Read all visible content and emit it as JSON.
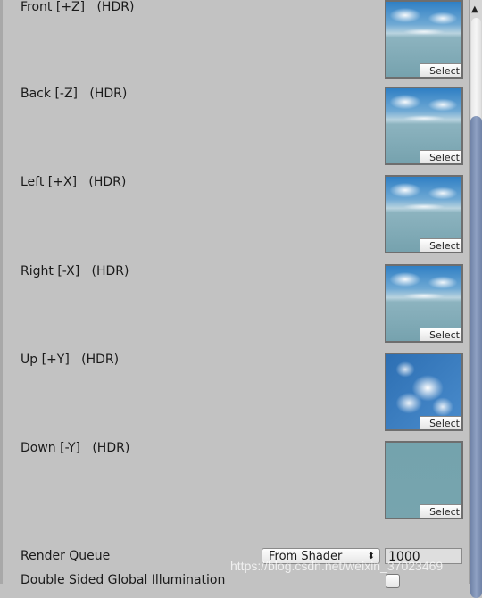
{
  "faces": [
    {
      "label": "Front [+Z]   (HDR)",
      "kind": "horizon"
    },
    {
      "label": "Back [-Z]   (HDR)",
      "kind": "horizon"
    },
    {
      "label": "Left [+X]   (HDR)",
      "kind": "horizon"
    },
    {
      "label": "Right [-X]   (HDR)",
      "kind": "horizon"
    },
    {
      "label": "Up [+Y]   (HDR)",
      "kind": "up"
    },
    {
      "label": "Down [-Y]   (HDR)",
      "kind": "down"
    }
  ],
  "select_label": "Select",
  "render_queue": {
    "label": "Render Queue",
    "mode": "From Shader",
    "value": "1000"
  },
  "double_sided_gi": {
    "label": "Double Sided Global Illumination",
    "checked": false
  },
  "watermark": "https://blog.csdn.net/weixin_37023469",
  "colors": {
    "panel": "#c2c2c2",
    "scroll_thumb": "#7f92b5"
  }
}
